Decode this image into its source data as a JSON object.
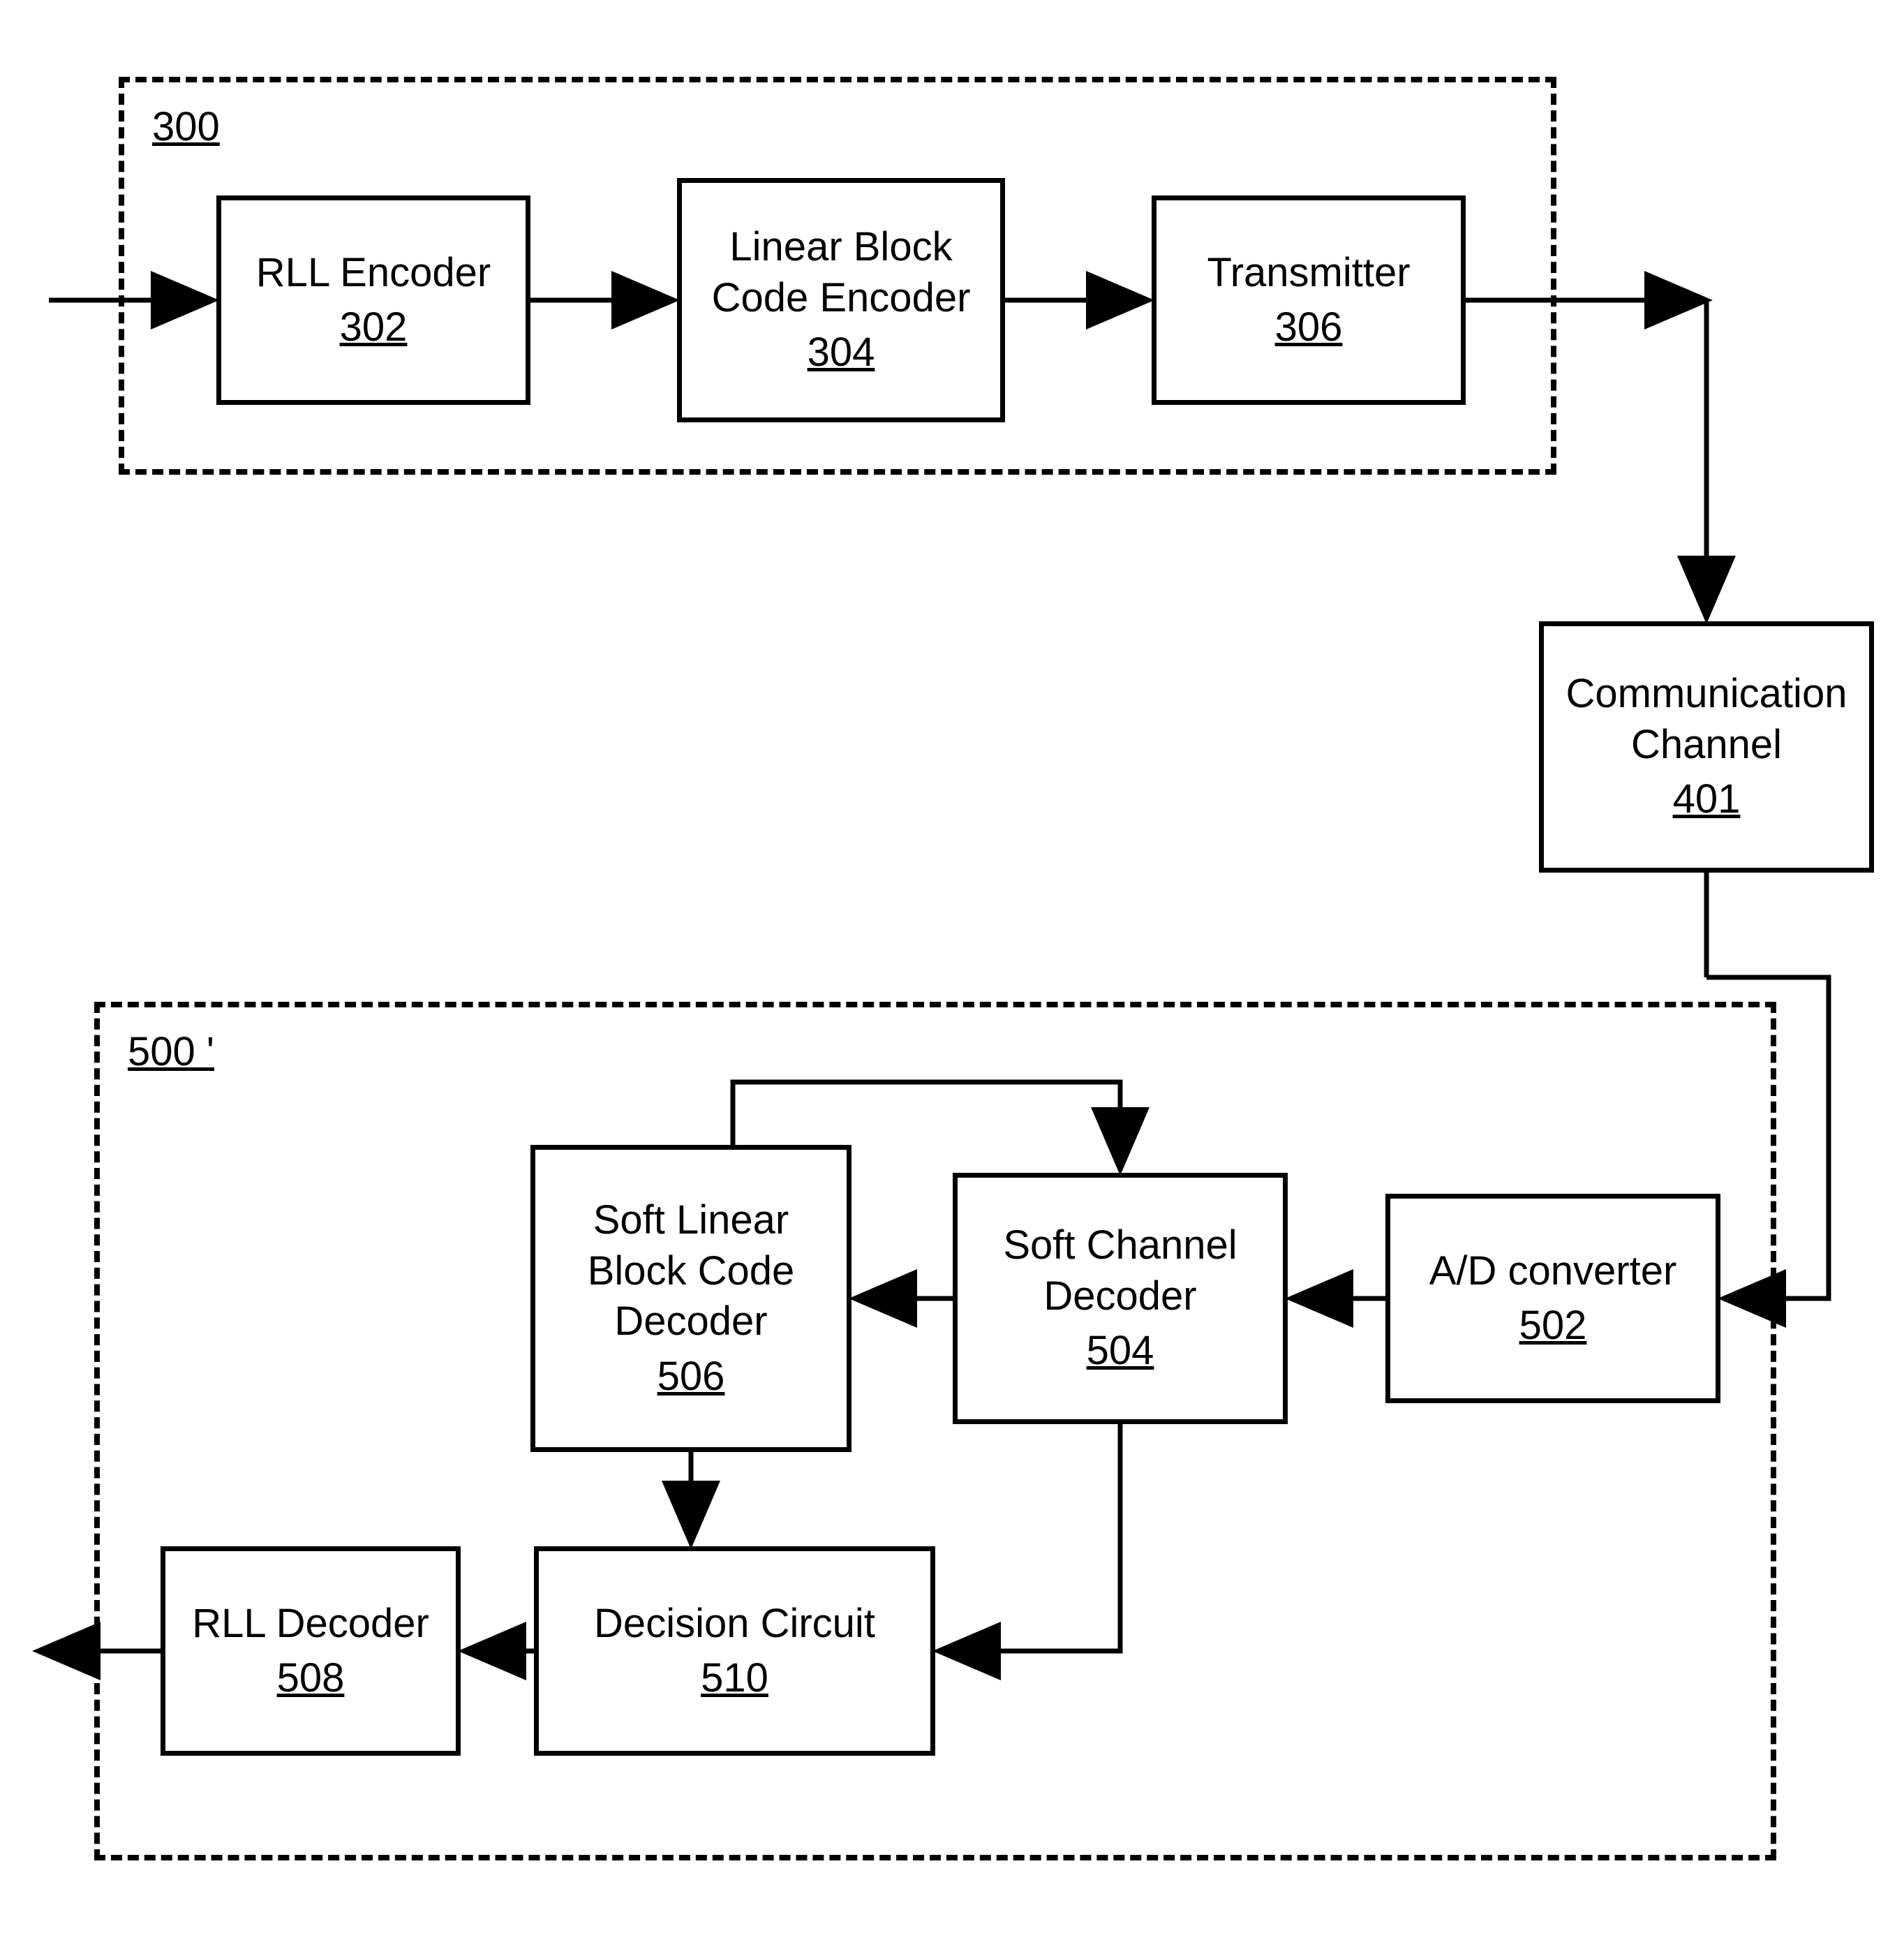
{
  "groups": {
    "tx": {
      "ref": "300"
    },
    "rx": {
      "ref": "500 '"
    }
  },
  "blocks": {
    "rll_encoder": {
      "label": "RLL Encoder",
      "ref": "302"
    },
    "lbc_encoder": {
      "label1": "Linear Block",
      "label2": "Code Encoder",
      "ref": "304"
    },
    "transmitter": {
      "label": "Transmitter",
      "ref": "306"
    },
    "comm_channel": {
      "label1": "Communication",
      "label2": "Channel",
      "ref": "401"
    },
    "ad_converter": {
      "label": "A/D converter",
      "ref": "502"
    },
    "soft_channel_dec": {
      "label1": "Soft Channel",
      "label2": "Decoder",
      "ref": "504"
    },
    "soft_lbc_dec": {
      "label1": "Soft Linear",
      "label2": "Block Code",
      "label3": "Decoder",
      "ref": "506"
    },
    "rll_decoder": {
      "label": "RLL Decoder",
      "ref": "508"
    },
    "decision_circuit": {
      "label": "Decision Circuit",
      "ref": "510"
    }
  }
}
